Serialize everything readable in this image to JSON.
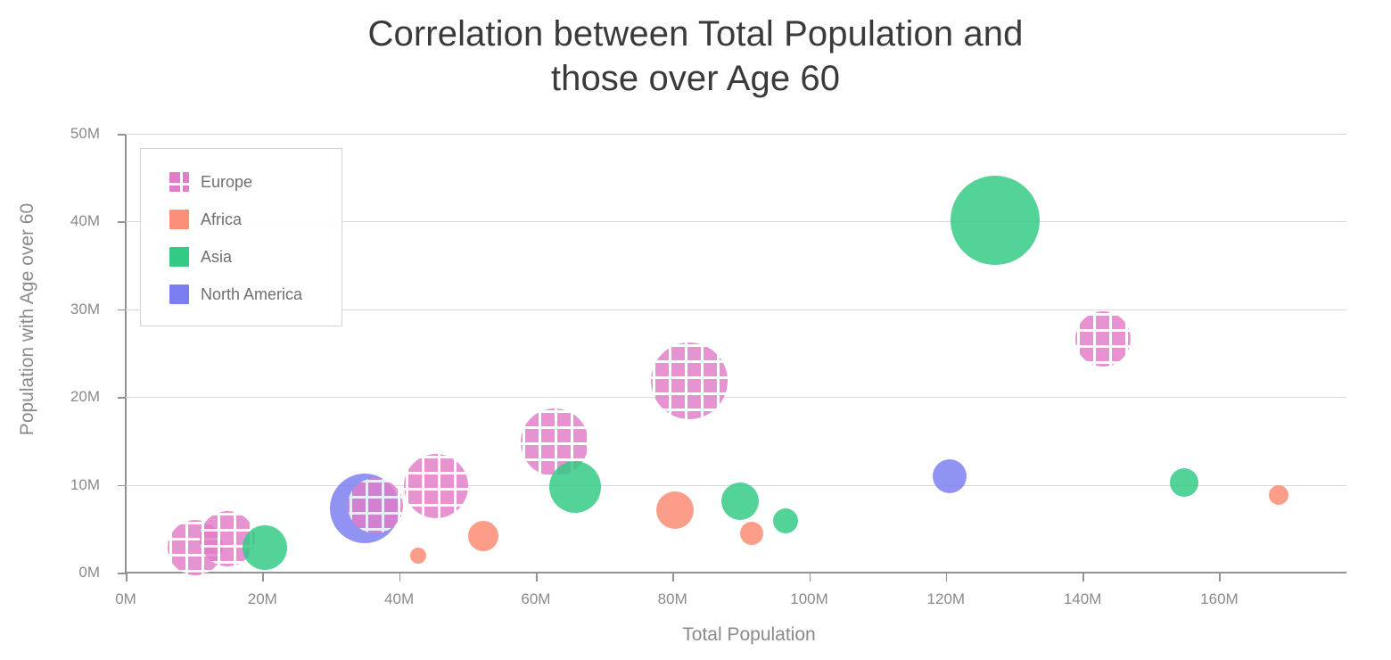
{
  "chart_data": {
    "type": "scatter",
    "subtype": "bubble",
    "title": "Correlation between Total Population and\nthose over Age 60",
    "xlabel": "Total Population",
    "ylabel": "Population with Age over 60",
    "xlim": [
      0,
      178.6
    ],
    "ylim": [
      0,
      50
    ],
    "x_unit": "M",
    "y_unit": "M",
    "grid": "horizontal",
    "legend_position": "top-left",
    "x_ticks": [
      "0M",
      "20M",
      "40M",
      "60M",
      "80M",
      "100M",
      "120M",
      "140M",
      "160M"
    ],
    "x_tick_values": [
      0,
      20,
      40,
      60,
      80,
      100,
      120,
      140,
      160
    ],
    "y_ticks": [
      "0M",
      "10M",
      "20M",
      "30M",
      "40M",
      "50M"
    ],
    "y_tick_values": [
      0,
      10,
      20,
      30,
      40,
      50
    ],
    "series": [
      {
        "name": "Europe",
        "color": "#e27cc9",
        "pattern": "grid",
        "points": [
          {
            "x": 10.2,
            "y": 2.8,
            "r": 31
          },
          {
            "x": 14.9,
            "y": 3.9,
            "r": 31
          },
          {
            "x": 36.5,
            "y": 7.6,
            "r": 31
          },
          {
            "x": 45.4,
            "y": 9.9,
            "r": 36
          },
          {
            "x": 62.7,
            "y": 14.8,
            "r": 38
          },
          {
            "x": 82.5,
            "y": 21.9,
            "r": 43
          },
          {
            "x": 143.0,
            "y": 26.6,
            "r": 31
          }
        ]
      },
      {
        "name": "Africa",
        "color": "#fb8f79",
        "pattern": "solid",
        "points": [
          {
            "x": 42.8,
            "y": 1.9,
            "r": 9
          },
          {
            "x": 52.3,
            "y": 4.2,
            "r": 17
          },
          {
            "x": 80.4,
            "y": 7.1,
            "r": 21
          },
          {
            "x": 91.6,
            "y": 4.5,
            "r": 13
          },
          {
            "x": 168.7,
            "y": 8.8,
            "r": 11
          }
        ]
      },
      {
        "name": "Asia",
        "color": "#33ca85",
        "pattern": "solid",
        "points": [
          {
            "x": 20.3,
            "y": 2.8,
            "r": 25
          },
          {
            "x": 65.8,
            "y": 9.8,
            "r": 29
          },
          {
            "x": 89.9,
            "y": 8.1,
            "r": 21
          },
          {
            "x": 96.6,
            "y": 5.9,
            "r": 14
          },
          {
            "x": 127.2,
            "y": 40.1,
            "r": 50
          },
          {
            "x": 154.8,
            "y": 10.3,
            "r": 16
          }
        ]
      },
      {
        "name": "North America",
        "color": "#7b7ef0",
        "pattern": "solid",
        "points": [
          {
            "x": 35.0,
            "y": 7.3,
            "r": 39
          },
          {
            "x": 120.6,
            "y": 11.0,
            "r": 19
          }
        ]
      }
    ]
  },
  "legend": {
    "items": [
      {
        "label": "Europe",
        "key": "europe"
      },
      {
        "label": "Africa",
        "key": "africa"
      },
      {
        "label": "Asia",
        "key": "asia"
      },
      {
        "label": "North America",
        "key": "northamerica"
      }
    ]
  }
}
